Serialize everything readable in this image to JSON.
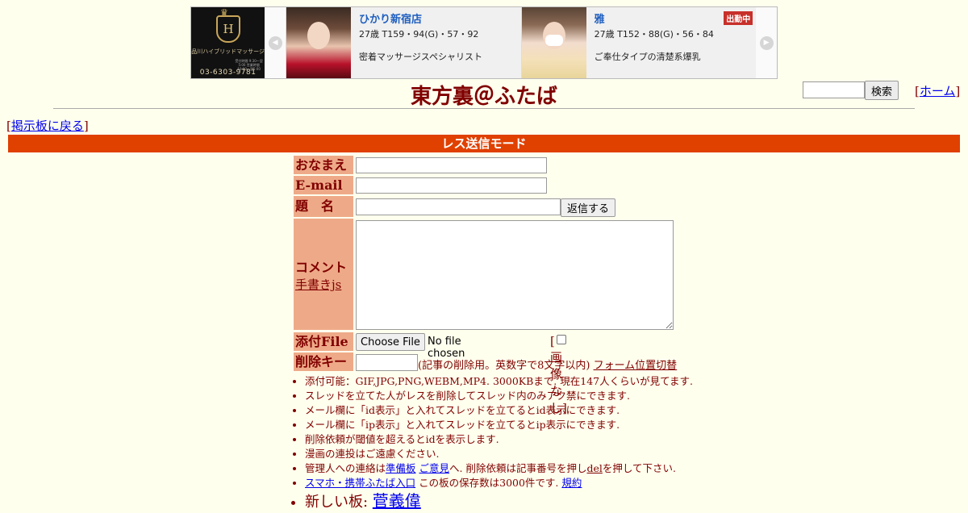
{
  "ad": {
    "logo": {
      "crest_letter": "H",
      "shop_name": "品川ハイブリッドマッサージ",
      "hours": "受付時間 9:30〜翌5:00 営業時間 10:00〜翌5:00",
      "tel": "03-6303-9781"
    },
    "cards": [
      {
        "name": "ひかり新宿店",
        "stats": "27歳 T159・94(G)・57・92",
        "desc": "密着マッサージスペシャリスト",
        "badge": ""
      },
      {
        "name": "雅",
        "stats": "27歳 T152・88(G)・56・84",
        "desc": "ご奉仕タイプの清楚系爆乳",
        "badge": "出勤中"
      }
    ]
  },
  "header": {
    "title": "東方裏＠ふたば",
    "search_button": "検索",
    "search_value": "",
    "home_link": "ホーム",
    "back_link": "掲示板に戻る"
  },
  "mode_title": "レス送信モード",
  "form": {
    "name_label": "おなまえ",
    "email_label": "E-mail",
    "subject_label": "題　名",
    "submit_button": "返信する",
    "comment_label": "コメント",
    "handwriting_link": "手書きjs",
    "file_label": "添付File",
    "choose_file_button": "Choose File",
    "no_file_text": "No file chosen",
    "no_image_label": "画像なし",
    "delete_key_label": "削除キー",
    "delete_key_hint": "(記事の削除用。英数字で8文字以内)",
    "form_position_link": "フォーム位置切替"
  },
  "rules": {
    "r1": "添付可能：GIF,JPG,PNG,WEBM,MP4. 3000KBまで. 現在147人くらいが見てます.",
    "r2": "スレッドを立てた人がレスを削除してスレッド内のみアク禁にできます.",
    "r3": "メール欄に「id表示」と入れてスレッドを立てるとid表示にできます.",
    "r4": "メール欄に「ip表示」と入れてスレッドを立てるとip表示にできます.",
    "r5": "削除依頼が閾値を超えるとidを表示します.",
    "r6": "漫画の連投はご遠慮ください.",
    "r7_prefix": "管理人への連絡は",
    "r7_link1": "準備板",
    "r7_link2": "ご意見",
    "r7_mid": "へ. 削除依頼は記事番号を押し",
    "r7_link3": "del",
    "r7_suffix": "を押して下さい.",
    "r8_link1": "スマホ・携帯ふたば入口",
    "r8_text": " この板の保存数は3000件です.",
    "r8_link2": "規約",
    "r9_prefix": "新しい板: ",
    "r9_link": "菅義偉"
  }
}
